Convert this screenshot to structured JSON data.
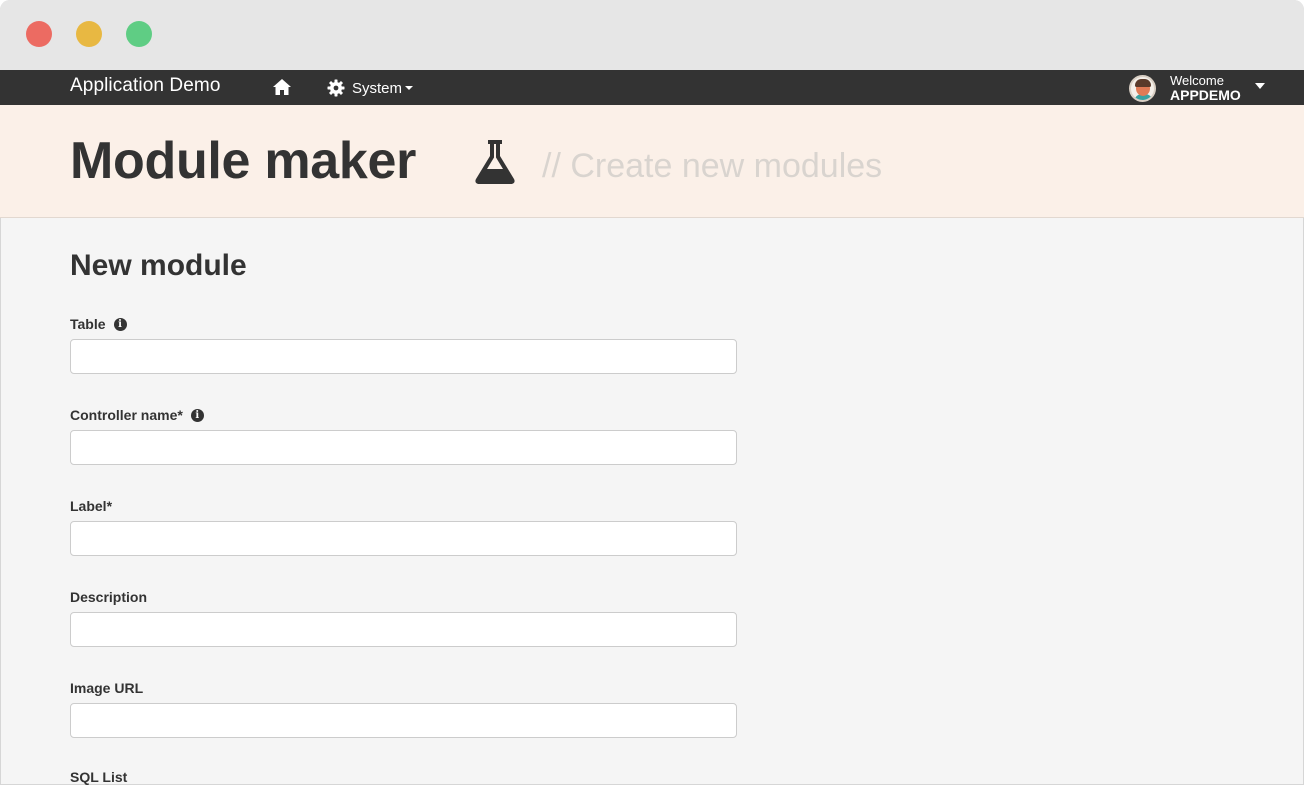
{
  "navbar": {
    "brand": "Application Demo",
    "home_icon": "home-icon",
    "system_label": "System",
    "welcome_label": "Welcome",
    "username": "APPDEMO"
  },
  "header": {
    "title": "Module maker",
    "title_icon": "flask-icon",
    "subtitle": "// Create new modules"
  },
  "form": {
    "section_title": "New module",
    "fields": [
      {
        "label": "Table",
        "value": "",
        "has_info": true
      },
      {
        "label": "Controller name*",
        "value": "",
        "has_info": true
      },
      {
        "label": "Label*",
        "value": "",
        "has_info": false
      },
      {
        "label": "Description",
        "value": "",
        "has_info": false
      },
      {
        "label": "Image URL",
        "value": "",
        "has_info": false
      },
      {
        "label": "SQL List",
        "value": "",
        "has_info": false
      }
    ]
  },
  "colors": {
    "navbar_bg": "#333333",
    "header_bg": "#fbf0e8",
    "content_bg": "#f5f5f5",
    "subtitle": "#d9d4cf",
    "traffic_red": "#ec6b62",
    "traffic_yellow": "#e8b842",
    "traffic_green": "#5fcd84"
  }
}
